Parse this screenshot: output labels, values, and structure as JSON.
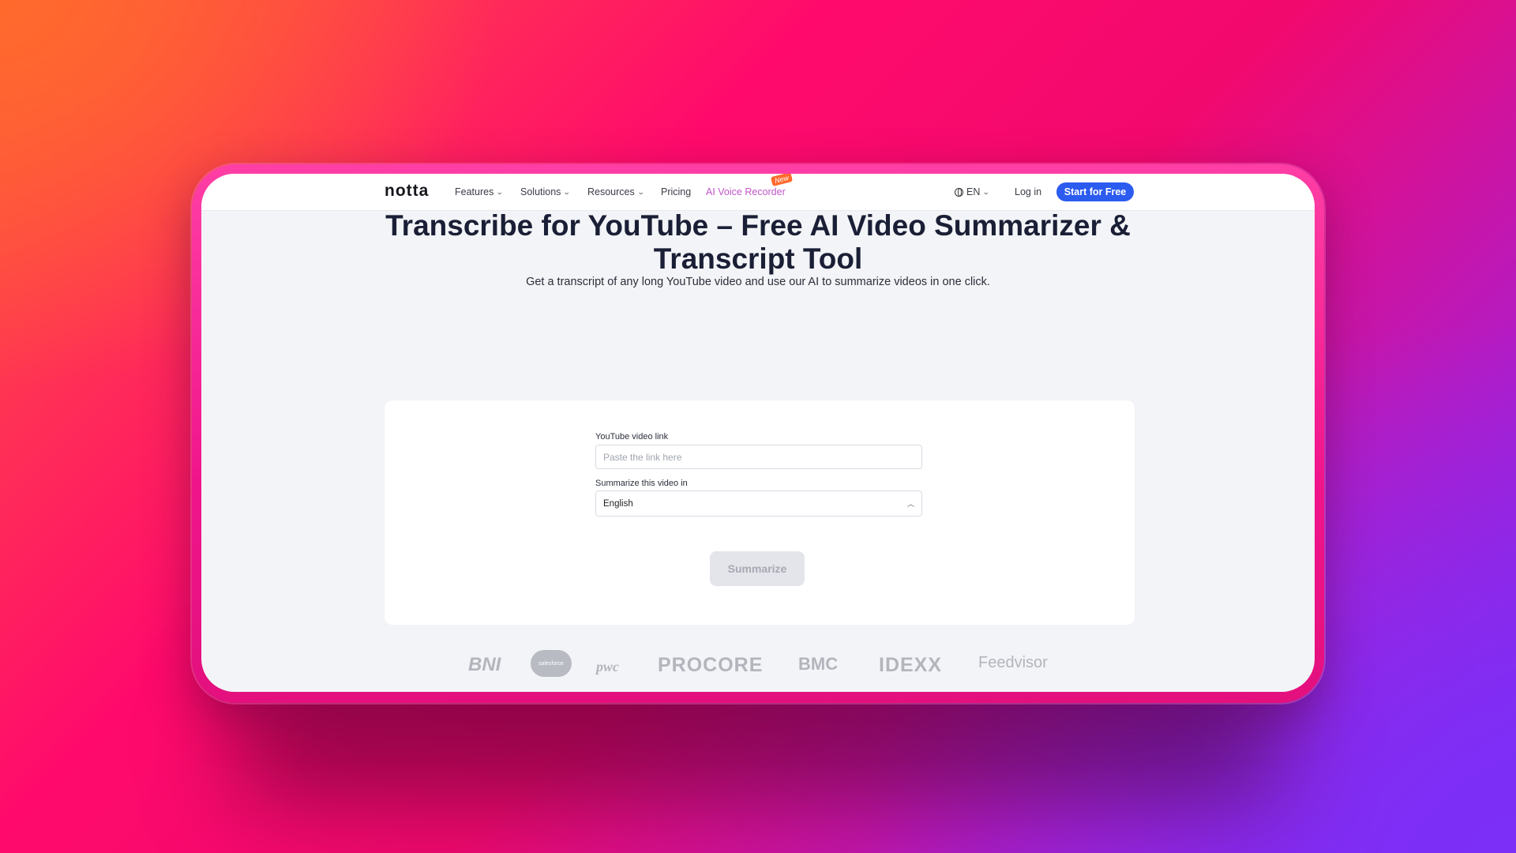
{
  "nav": {
    "logo": "notta",
    "items": [
      {
        "label": "Features"
      },
      {
        "label": "Solutions"
      },
      {
        "label": "Resources"
      },
      {
        "label": "Pricing"
      },
      {
        "label": "AI Voice Recorder"
      }
    ],
    "new_badge": "New",
    "language": "EN",
    "login": "Log in",
    "cta": "Start for Free"
  },
  "hero": {
    "title_line1": "Transcribe for YouTube – Free AI Video Summarizer &",
    "title_line2": "Transcript Tool",
    "subtitle": "Get a transcript of any long YouTube video and use our AI to summarize videos in one click."
  },
  "form": {
    "link_label": "YouTube video link",
    "link_placeholder": "Paste the link here",
    "lang_label": "Summarize this video in",
    "lang_value": "English",
    "button": "Summarize"
  },
  "logos": [
    "BNI",
    "salesforce",
    "pwc",
    "PROCORE",
    "BMC",
    "IDEXX",
    "Feedvisor"
  ],
  "colors": {
    "accent": "#2c5bf0",
    "voice_recorder": "#c157c9",
    "badge": "#ff6a2c"
  }
}
